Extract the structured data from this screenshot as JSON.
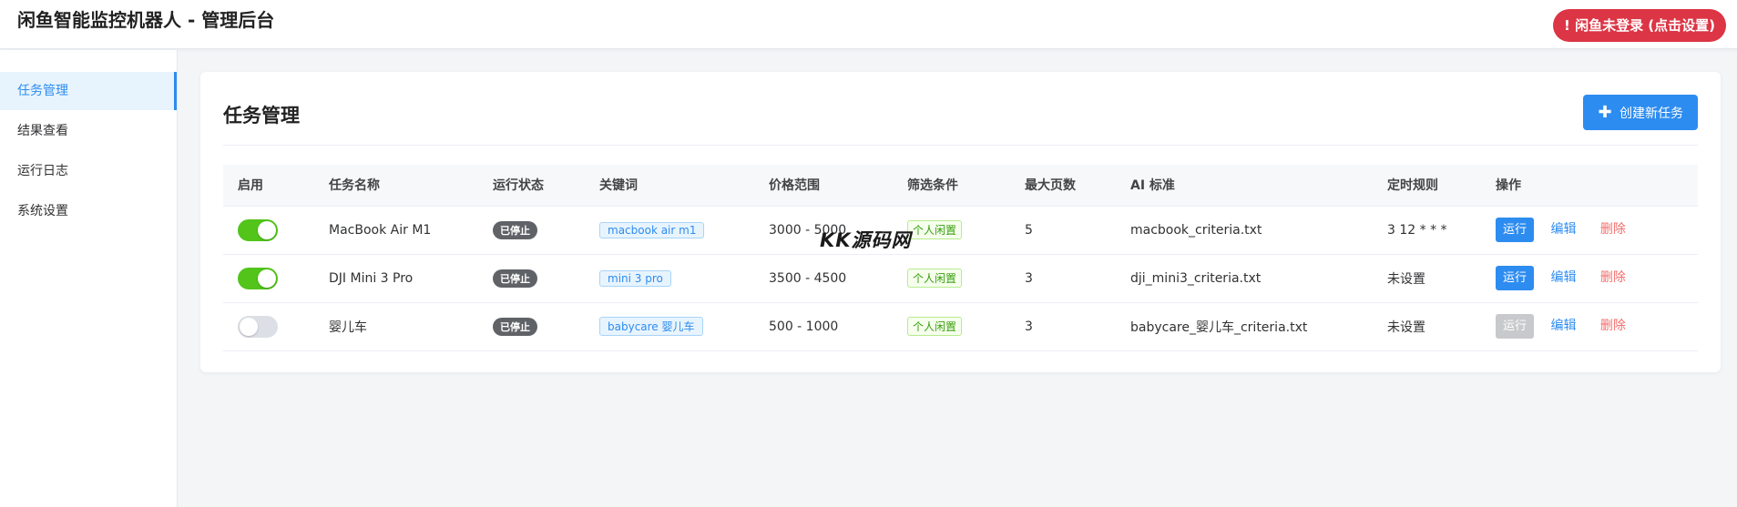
{
  "header": {
    "title": "闲鱼智能监控机器人 - 管理后台",
    "login_status": "! 闲鱼未登录 (点击设置)"
  },
  "sidebar": {
    "items": [
      {
        "label": "任务管理",
        "active": true
      },
      {
        "label": "结果查看",
        "active": false
      },
      {
        "label": "运行日志",
        "active": false
      },
      {
        "label": "系统设置",
        "active": false
      }
    ]
  },
  "main": {
    "title": "任务管理",
    "create_button": "创建新任务",
    "table": {
      "headers": [
        "启用",
        "任务名称",
        "运行状态",
        "关键词",
        "价格范围",
        "筛选条件",
        "最大页数",
        "AI 标准",
        "定时规则",
        "操作"
      ],
      "rows": [
        {
          "enabled": true,
          "name": "MacBook Air M1",
          "status": "已停止",
          "keyword": "macbook air m1",
          "price": "3000 - 5000",
          "filter": "个人闲置",
          "max_pages": "5",
          "ai_criteria": "macbook_criteria.txt",
          "schedule": "3 12 * * *",
          "run": "运行",
          "run_enabled": true,
          "edit": "编辑",
          "delete": "删除"
        },
        {
          "enabled": true,
          "name": "DJI Mini 3 Pro",
          "status": "已停止",
          "keyword": "mini 3 pro",
          "price": "3500 - 4500",
          "filter": "个人闲置",
          "max_pages": "3",
          "ai_criteria": "dji_mini3_criteria.txt",
          "schedule": "未设置",
          "run": "运行",
          "run_enabled": true,
          "edit": "编辑",
          "delete": "删除"
        },
        {
          "enabled": false,
          "name": "婴儿车",
          "status": "已停止",
          "keyword": "babycare 婴儿车",
          "price": "500 - 1000",
          "filter": "个人闲置",
          "max_pages": "3",
          "ai_criteria": "babycare_婴儿车_criteria.txt",
          "schedule": "未设置",
          "run": "运行",
          "run_enabled": false,
          "edit": "编辑",
          "delete": "删除"
        }
      ]
    }
  },
  "watermark": "KK源码网",
  "colors": {
    "primary": "#2d8cf0",
    "danger": "#dc3545",
    "switch_on": "#52c41a",
    "status_stopped": "#5f6368"
  }
}
